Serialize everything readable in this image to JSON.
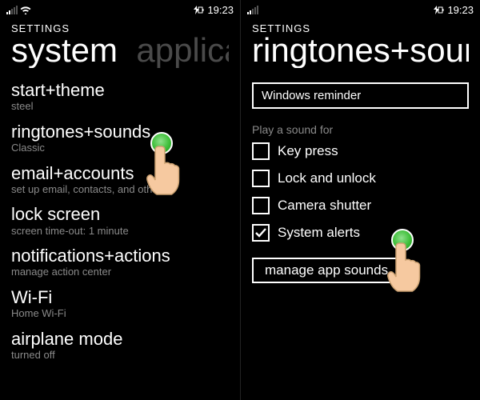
{
  "left": {
    "status": {
      "time": "19:23"
    },
    "header": {
      "label": "SETTINGS",
      "pivot_active": "system",
      "pivot_next": "applications"
    },
    "items": [
      {
        "title": "start+theme",
        "subtitle": "steel"
      },
      {
        "title": "ringtones+sounds",
        "subtitle": "Classic"
      },
      {
        "title": "email+accounts",
        "subtitle": "set up email, contacts, and others"
      },
      {
        "title": "lock screen",
        "subtitle": "screen time-out: 1 minute"
      },
      {
        "title": "notifications+actions",
        "subtitle": "manage action center"
      },
      {
        "title": "Wi-Fi",
        "subtitle": "Home Wi-Fi"
      },
      {
        "title": "airplane mode",
        "subtitle": "turned off"
      }
    ]
  },
  "right": {
    "status": {
      "time": "19:23"
    },
    "header": {
      "label": "SETTINGS",
      "pivot_active": "ringtones+sounds"
    },
    "reminder_select": "Windows reminder",
    "section_label": "Play a sound for",
    "checks": [
      {
        "label": "Key press",
        "checked": false
      },
      {
        "label": "Lock and unlock",
        "checked": false
      },
      {
        "label": "Camera shutter",
        "checked": false
      },
      {
        "label": "System alerts",
        "checked": true
      }
    ],
    "manage_button": "manage app sounds"
  }
}
